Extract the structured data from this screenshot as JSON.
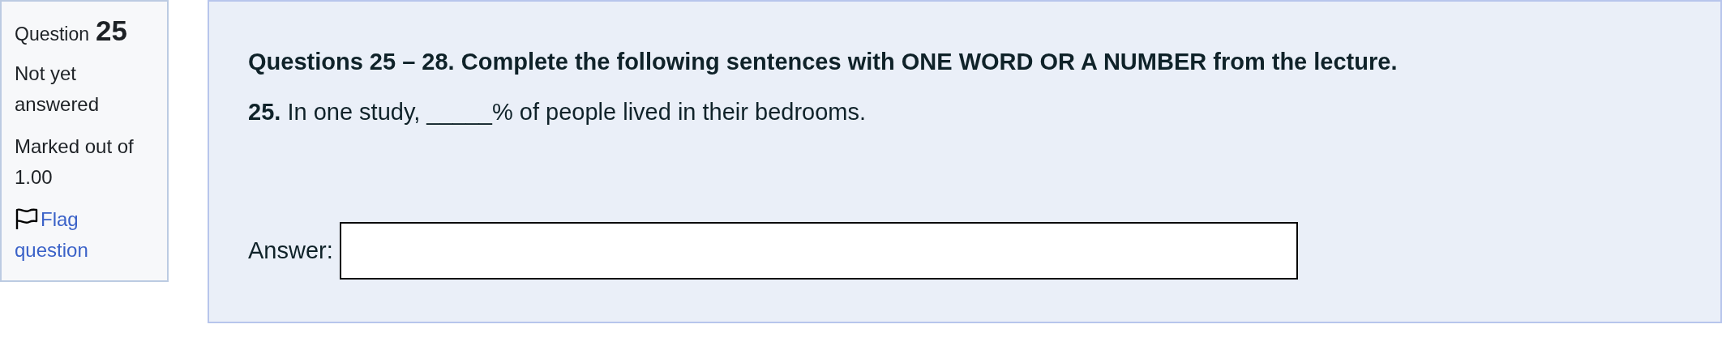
{
  "info": {
    "label": "Question",
    "number": "25",
    "status": "Not yet answered",
    "marks": "Marked out of 1.00",
    "flag": {
      "label": "Flag question",
      "flagged": false
    }
  },
  "question": {
    "heading": "Questions 25 – 28. Complete the following sentences with ONE WORD OR A NUMBER from the lecture.",
    "text": "**25.** In one study, _____% of people lived in their bedrooms.",
    "answer_label": "Answer:"
  }
}
